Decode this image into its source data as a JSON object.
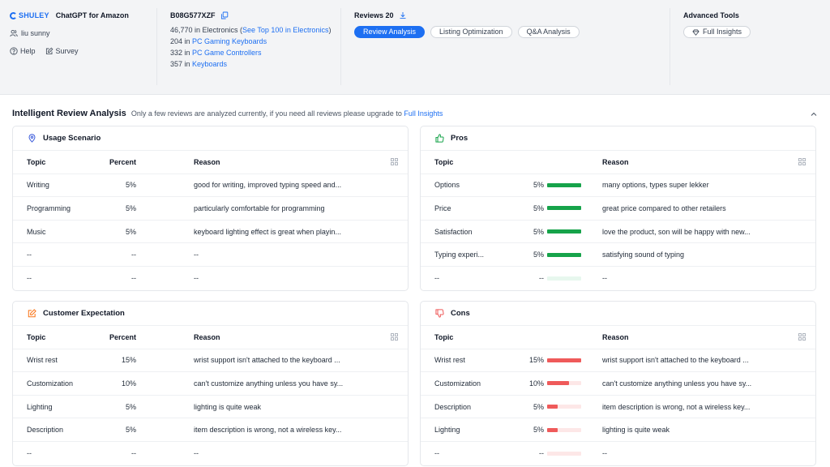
{
  "header": {
    "brand": "SHULEY",
    "app_title": "ChatGPT for Amazon",
    "user": "liu sunny",
    "help": "Help",
    "survey": "Survey",
    "asin": "B08G577XZF",
    "rank_main": {
      "prefix": "46,770 in Electronics (",
      "link": "See Top 100 in Electronics",
      "suffix": ")"
    },
    "ranks": [
      {
        "num": "204 in ",
        "link": "PC Gaming Keyboards"
      },
      {
        "num": "332 in ",
        "link": "PC Game Controllers"
      },
      {
        "num": "357 in ",
        "link": "Keyboards"
      }
    ],
    "reviews_label": "Reviews 20",
    "tabs": [
      {
        "label": "Review Analysis",
        "active": true
      },
      {
        "label": "Listing Optimization",
        "active": false
      },
      {
        "label": "Q&A Analysis",
        "active": false
      }
    ],
    "tools_title": "Advanced Tools",
    "full_insights": "Full Insights"
  },
  "section": {
    "title": "Intelligent Review Analysis",
    "note": "Only a few reviews are analyzed currently, if you need all reviews please upgrade to",
    "note_link": "Full Insights"
  },
  "cols": {
    "topic": "Topic",
    "percent": "Percent",
    "reason": "Reason"
  },
  "colors": {
    "accent": "#1d6ff2",
    "pros": "#16a34a",
    "cons": "#ef5a5a",
    "usage_icon": "#3b5bdb",
    "expect_icon": "#f97316"
  },
  "usage": {
    "title": "Usage Scenario",
    "icon": "location-pin-icon",
    "rows": [
      {
        "topic": "Writing",
        "percent": "5%",
        "reason": "good for writing, improved typing speed and..."
      },
      {
        "topic": "Programming",
        "percent": "5%",
        "reason": "particularly comfortable for programming"
      },
      {
        "topic": "Music",
        "percent": "5%",
        "reason": "keyboard lighting effect is great when playin..."
      },
      {
        "topic": "--",
        "percent": "--",
        "reason": "--"
      },
      {
        "topic": "--",
        "percent": "--",
        "reason": "--"
      }
    ]
  },
  "pros": {
    "title": "Pros",
    "icon": "thumbs-up-icon",
    "rows": [
      {
        "topic": "Options",
        "percent": "5%",
        "share": 1.0,
        "reason": "many options, types super lekker"
      },
      {
        "topic": "Price",
        "percent": "5%",
        "share": 1.0,
        "reason": "great price compared to other retailers"
      },
      {
        "topic": "Satisfaction",
        "percent": "5%",
        "share": 1.0,
        "reason": "love the product, son will be happy with new..."
      },
      {
        "topic": "Typing experi...",
        "percent": "5%",
        "share": 1.0,
        "reason": "satisfying sound of typing"
      },
      {
        "topic": "--",
        "percent": "--",
        "share": 0,
        "reason": "--"
      }
    ]
  },
  "expectation": {
    "title": "Customer Expectation",
    "icon": "edit-icon",
    "rows": [
      {
        "topic": "Wrist rest",
        "percent": "15%",
        "reason": "wrist support isn't attached to the keyboard ..."
      },
      {
        "topic": "Customization",
        "percent": "10%",
        "reason": "can't customize anything unless you have sy..."
      },
      {
        "topic": "Lighting",
        "percent": "5%",
        "reason": "lighting is quite weak"
      },
      {
        "topic": "Description",
        "percent": "5%",
        "reason": "item description is wrong, not a wireless key..."
      },
      {
        "topic": "--",
        "percent": "--",
        "reason": "--"
      }
    ]
  },
  "cons": {
    "title": "Cons",
    "icon": "thumbs-down-icon",
    "rows": [
      {
        "topic": "Wrist rest",
        "percent": "15%",
        "share": 1.0,
        "reason": "wrist support isn't attached to the keyboard ..."
      },
      {
        "topic": "Customization",
        "percent": "10%",
        "share": 0.65,
        "reason": "can't customize anything unless you have sy..."
      },
      {
        "topic": "Description",
        "percent": "5%",
        "share": 0.32,
        "reason": "item description is wrong, not a wireless key..."
      },
      {
        "topic": "Lighting",
        "percent": "5%",
        "share": 0.32,
        "reason": "lighting is quite weak"
      },
      {
        "topic": "--",
        "percent": "--",
        "share": 0,
        "reason": "--"
      }
    ]
  }
}
